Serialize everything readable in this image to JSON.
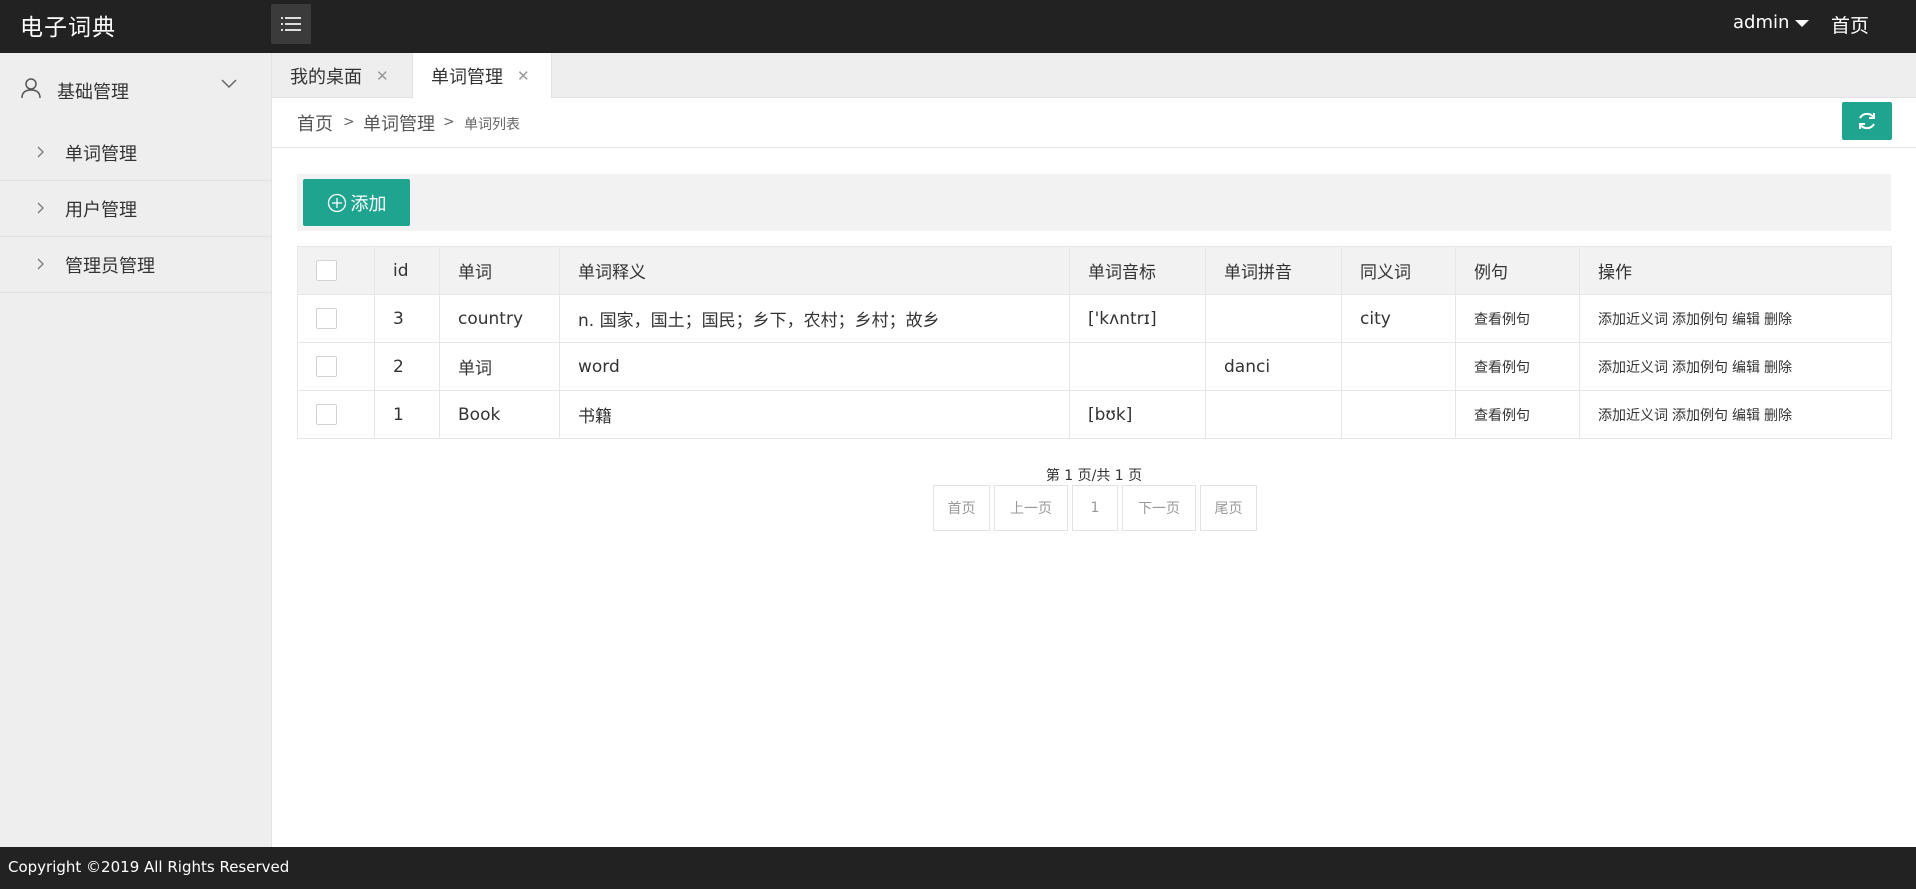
{
  "header": {
    "logo": "电子词典",
    "user": "admin",
    "home": "首页"
  },
  "sidebar": {
    "group_label": "基础管理",
    "items": [
      {
        "label": "单词管理"
      },
      {
        "label": "用户管理"
      },
      {
        "label": "管理员管理"
      }
    ]
  },
  "tabs": [
    {
      "label": "我的桌面",
      "close": "✕"
    },
    {
      "label": "单词管理",
      "close": "✕"
    }
  ],
  "breadcrumb": {
    "home": "首页",
    "section": "单词管理",
    "current": "单词列表",
    "sep": ">"
  },
  "toolbar": {
    "add_label": "添加"
  },
  "table": {
    "headers": [
      "id",
      "单词",
      "单词释义",
      "单词音标",
      "单词拼音",
      "同义词",
      "例句",
      "操作"
    ],
    "rows": [
      {
        "id": "3",
        "word": "country",
        "meaning": "n. 国家，国土；国民；乡下，农村；乡村；故乡",
        "phonetic": "['kʌntrɪ]",
        "pinyin": "",
        "synonym": "city",
        "example": "查看例句"
      },
      {
        "id": "2",
        "word": "单词",
        "meaning": "word",
        "phonetic": "",
        "pinyin": "danci",
        "synonym": "",
        "example": "查看例句"
      },
      {
        "id": "1",
        "word": "Book",
        "meaning": "书籍",
        "phonetic": "[bʊk]",
        "pinyin": "",
        "synonym": "",
        "example": "查看例句"
      }
    ],
    "actions": {
      "add_synonym": "添加近义词",
      "add_example": "添加例句",
      "edit": "编辑",
      "delete": "删除"
    }
  },
  "pagination": {
    "info": "第 1 页/共 1 页",
    "first": "首页",
    "prev": "上一页",
    "current": "1",
    "next": "下一页",
    "last": "尾页"
  },
  "footer": {
    "copyright": "Copyright ©2019 All Rights Reserved"
  },
  "colors": {
    "header_bg": "#222222",
    "accent": "#1fa490",
    "sidebar_bg": "#eeeeee"
  }
}
